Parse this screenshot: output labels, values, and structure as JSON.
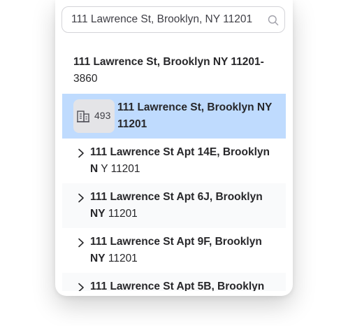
{
  "search": {
    "value": "111 Lawrence St, Brooklyn, NY 11201",
    "icon": "search-icon"
  },
  "header_item": {
    "bold": "111 Lawrence St, Brooklyn NY 11201-",
    "rest": "3860"
  },
  "selected_item": {
    "icon": "building-icon",
    "count": "493",
    "bold": "111 Lawrence St, Brooklyn NY 11201",
    "rest": ""
  },
  "results": [
    {
      "bold": "111 Lawrence St Apt 14E, Brooklyn N",
      "rest": " Y 11201"
    },
    {
      "bold": "111 Lawrence St Apt 6J, Brooklyn NY",
      "rest": " 11201"
    },
    {
      "bold": "111 Lawrence St Apt 9F, Brooklyn NY",
      "rest": " 11201"
    },
    {
      "bold": "111 Lawrence St Apt 5B, Brooklyn",
      "rest": ""
    }
  ],
  "colors": {
    "selected_bg": "#bfdbfe",
    "badge_bg": "#e4e4e7",
    "text": "#27272a"
  }
}
